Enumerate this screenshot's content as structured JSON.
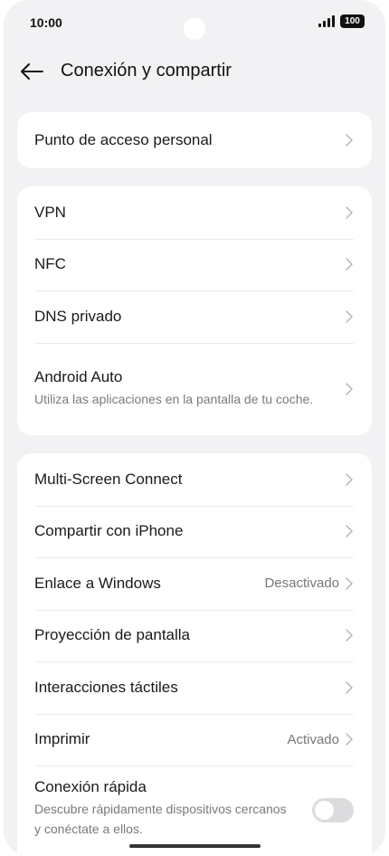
{
  "status_bar": {
    "time": "10:00",
    "battery": "100"
  },
  "header": {
    "title": "Conexión y compartir"
  },
  "group1": [
    {
      "label": "Punto de acceso personal"
    }
  ],
  "group2": [
    {
      "label": "VPN"
    },
    {
      "label": "NFC"
    },
    {
      "label": "DNS privado"
    },
    {
      "label": "Android Auto",
      "subtitle": "Utiliza las aplicaciones en la pantalla de tu coche."
    }
  ],
  "group3": [
    {
      "label": "Multi-Screen Connect"
    },
    {
      "label": "Compartir con iPhone"
    },
    {
      "label": "Enlace a Windows",
      "value": "Desactivado"
    },
    {
      "label": "Proyección de pantalla"
    },
    {
      "label": "Interacciones táctiles"
    },
    {
      "label": "Imprimir",
      "value": "Activado"
    },
    {
      "label": "Conexión rápida",
      "subtitle": "Descubre rápidamente dispositivos cercanos y conéctate a ellos.",
      "toggle": false
    }
  ],
  "colors": {
    "background": "#f2f2f4",
    "card": "#ffffff",
    "toggle_off": "#dcdcde"
  }
}
